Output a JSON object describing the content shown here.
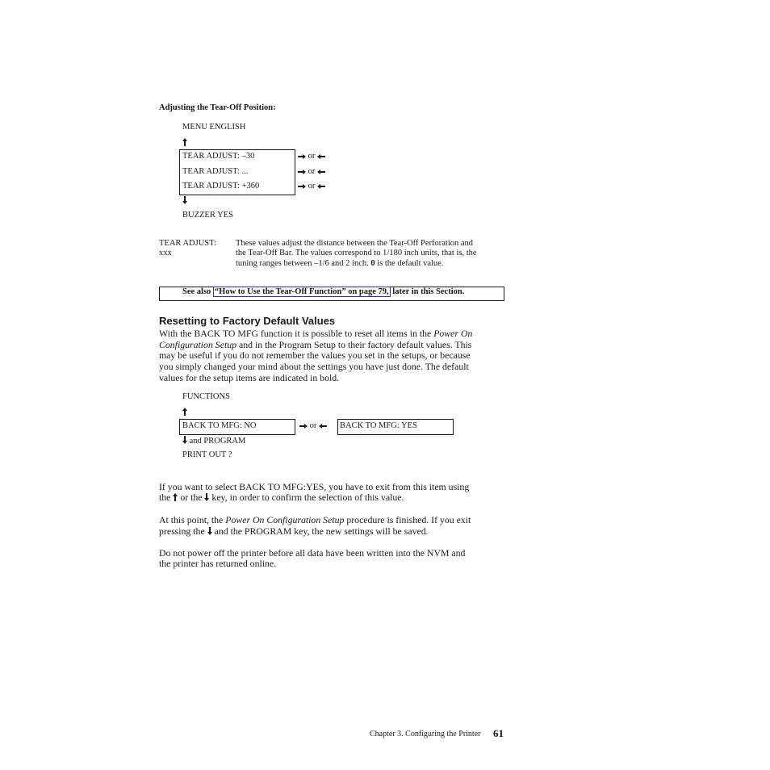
{
  "section1": {
    "heading": "Adjusting the Tear-Off Position:",
    "menu_above": "MENU ENGLISH",
    "up_arrow_icon": "↑",
    "box_items": [
      "TEAR ADJUST: –30",
      "TEAR ADJUST: ...",
      "TEAR ADJUST: +360"
    ],
    "right_arrow": "➡",
    "or_label": "or",
    "left_arrow": "⬅",
    "down_arrow_icon": "↓",
    "menu_below": "BUZZER YES",
    "def_term_line1": "TEAR ADJUST:",
    "def_term_line2": "xxx",
    "def_text_line1": "These values adjust the distance between the Tear-Off Perforation and",
    "def_text_line2": "the Tear-Off Bar. The values correspond to 1/180 inch units, that is, the",
    "def_text_line3_pre": "tuning ranges between –1/6 and 2 inch. ",
    "def_text_line3_bold": "0",
    "def_text_line3_post": " is the default value.",
    "see_also_pre": "See also",
    "see_also_link": "“How to Use the Tear-Off Function” on page 79,",
    "see_also_post": "later in this Section."
  },
  "section2": {
    "heading": "Resetting to Factory Default Values",
    "para1_line1_pre": "With the BACK TO MFG function it is possible to reset all items in the ",
    "para1_line1_ital": "Power On",
    "para1_line2_ital": "Configuration Setup",
    "para1_line2_post": " and in the Program Setup to their factory default values. This",
    "para1_line3": "may be useful if you do not remember the values you set in the setups, or because",
    "para1_line4": "you simply changed your mind about the settings you have just done. The default",
    "para1_line5": "values for the setup items are indicated in bold.",
    "menu_above": "FUNCTIONS",
    "box_left": "BACK TO MFG: NO",
    "box_right": "BACK TO MFG: YES",
    "and_program": "and PROGRAM",
    "print_out": "PRINT OUT ?",
    "para2_line1": "If you want to select BACK TO MFG:YES, you have to exit from this item using",
    "para2_line2_a": "the ",
    "para2_line2_b": " or the ",
    "para2_line2_c": " key, in order to confirm the selection of this value.",
    "para3_line1_pre": "At this point, the ",
    "para3_line1_ital": "Power On Configuration Setup",
    "para3_line1_post": " procedure is finished. If you exit",
    "para3_line2_a": "pressing the ",
    "para3_line2_b": " and the PROGRAM key, the new settings will be saved.",
    "para4_line1": "Do not power off the printer before all data have been written into the NVM and",
    "para4_line2": "the printer has returned online."
  },
  "footer": {
    "chapter": "Chapter 3. Configuring the Printer",
    "page_number": "61"
  }
}
